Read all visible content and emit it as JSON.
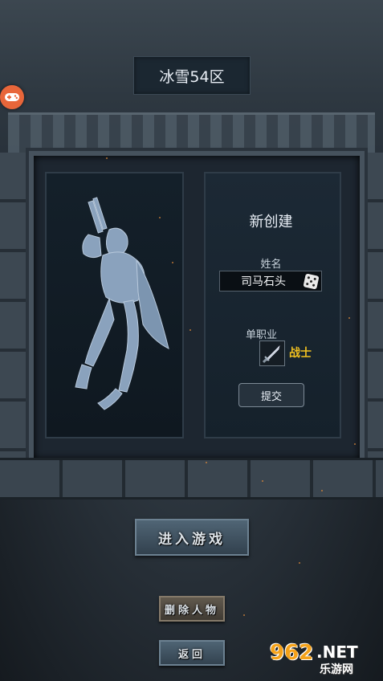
{
  "server": {
    "name": "冰雪54区"
  },
  "create": {
    "title": "新创建",
    "name_label": "姓名",
    "name_value": "司马石头",
    "class_label": "单职业",
    "class_name": "战士",
    "submit_label": "提交"
  },
  "buttons": {
    "enter_game": "进入游戏",
    "delete_character": "删除人物",
    "back": "返回"
  },
  "watermark": {
    "number": "962",
    "net": ".NET",
    "cn": "乐游网"
  },
  "colors": {
    "class_name": "#f0c020",
    "gamepad": "#e8663a"
  }
}
